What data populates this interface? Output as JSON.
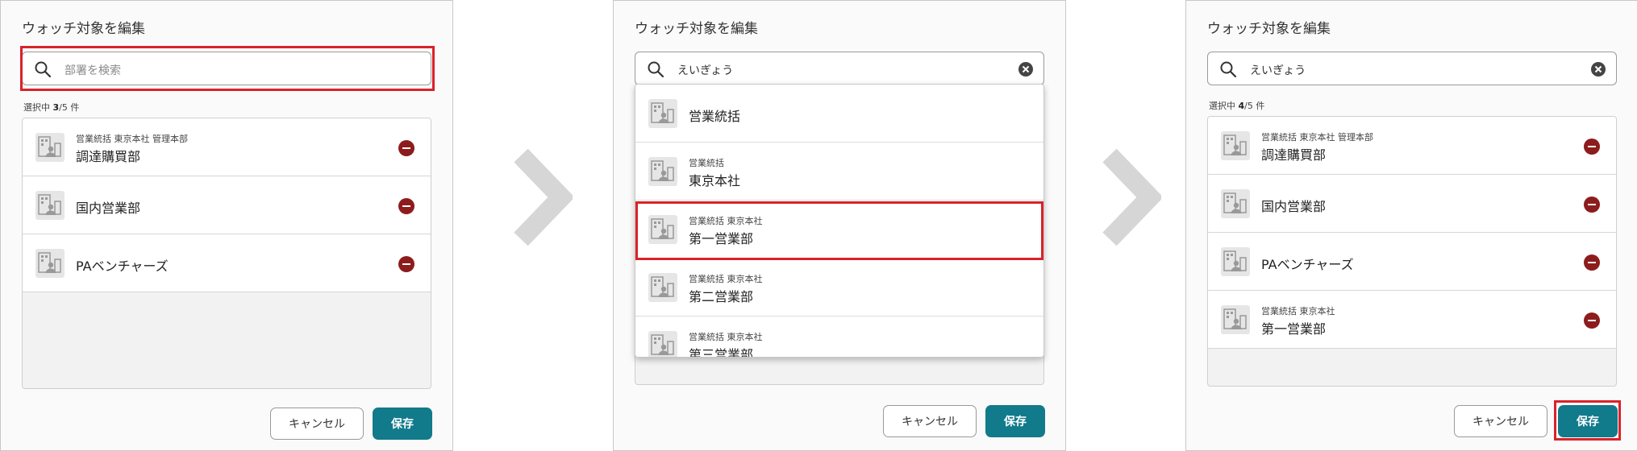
{
  "dialog_title": "ウォッチ対象を編集",
  "cancel_label": "キャンセル",
  "save_label": "保存",
  "colors": {
    "accent": "#117a8b",
    "remove": "#8d1c1c",
    "highlight": "#d9222a",
    "arrow": "#d6d6d6"
  },
  "icons": [
    "search-icon",
    "clear-icon",
    "department-icon",
    "remove-icon",
    "chevron-right-icon"
  ],
  "step1": {
    "search_placeholder": "部署を検索",
    "count_prefix": "選択中 ",
    "count_selected": "3",
    "count_suffix": "/5 件",
    "items": [
      {
        "crumb": "営業統括 東京本社 管理本部",
        "name": "調達購買部"
      },
      {
        "crumb": "",
        "name": "国内営業部"
      },
      {
        "crumb": "",
        "name": "PAベンチャーズ"
      }
    ]
  },
  "step2": {
    "search_value": "えいぎょう",
    "results": [
      {
        "crumb": "",
        "name": "営業統括"
      },
      {
        "crumb": "営業統括",
        "name": "東京本社"
      },
      {
        "crumb": "営業統括 東京本社",
        "name": "第一営業部"
      },
      {
        "crumb": "営業統括 東京本社",
        "name": "第二営業部"
      },
      {
        "crumb": "営業統括 東京本社",
        "name": "第三営業部"
      }
    ]
  },
  "step3": {
    "search_value": "えいぎょう",
    "count_prefix": "選択中 ",
    "count_selected": "4",
    "count_suffix": "/5 件",
    "items": [
      {
        "crumb": "営業統括 東京本社 管理本部",
        "name": "調達購買部"
      },
      {
        "crumb": "",
        "name": "国内営業部"
      },
      {
        "crumb": "",
        "name": "PAベンチャーズ"
      },
      {
        "crumb": "営業統括 東京本社",
        "name": "第一営業部"
      }
    ]
  }
}
